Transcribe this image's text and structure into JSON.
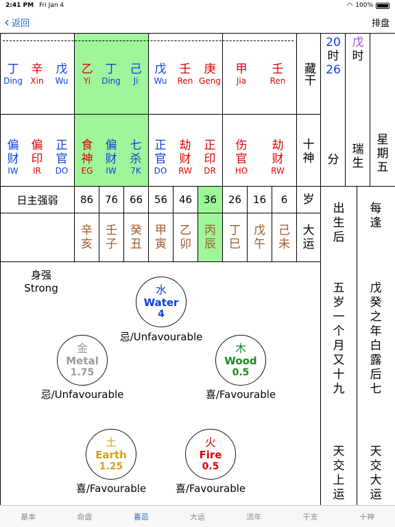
{
  "status": {
    "time": "2:41 PM",
    "date": "Fri Jan 4",
    "battery": "100%"
  },
  "nav": {
    "back_label": "返回",
    "right_label": "排盘"
  },
  "stems": [
    {
      "cols": [
        {
          "ch": "丁",
          "py": "Ding",
          "color": "blue"
        },
        {
          "ch": "辛",
          "py": "Xin",
          "color": "red"
        },
        {
          "ch": "戊",
          "py": "Wu",
          "color": "blue"
        }
      ]
    },
    {
      "cols": [
        {
          "ch": "乙",
          "py": "Yi",
          "color": "red"
        },
        {
          "ch": "丁",
          "py": "Ding",
          "color": "blue"
        },
        {
          "ch": "己",
          "py": "Ji",
          "color": "blue"
        }
      ]
    },
    {
      "cols": [
        {
          "ch": "戊",
          "py": "Wu",
          "color": "blue"
        },
        {
          "ch": "壬",
          "py": "Ren",
          "color": "red"
        },
        {
          "ch": "庚",
          "py": "Geng",
          "color": "red"
        }
      ]
    },
    {
      "cols": [
        {
          "ch": "甲",
          "py": "Jia",
          "color": "red"
        },
        {
          "ch": "壬",
          "py": "Ren",
          "color": "red"
        }
      ]
    }
  ],
  "gods": [
    {
      "cols": [
        {
          "a": "偏",
          "b": "财",
          "ab": "IW",
          "color": "blue"
        },
        {
          "a": "偏",
          "b": "印",
          "ab": "IR",
          "color": "red"
        },
        {
          "a": "正",
          "b": "官",
          "ab": "DO",
          "color": "blue"
        }
      ]
    },
    {
      "cols": [
        {
          "a": "食",
          "b": "神",
          "ab": "EG",
          "color": "red"
        },
        {
          "a": "偏",
          "b": "财",
          "ab": "IW",
          "color": "blue"
        },
        {
          "a": "七",
          "b": "杀",
          "ab": "7K",
          "color": "blue"
        }
      ]
    },
    {
      "cols": [
        {
          "a": "正",
          "b": "官",
          "ab": "DO",
          "color": "blue"
        },
        {
          "a": "劫",
          "b": "财",
          "ab": "RW",
          "color": "red"
        },
        {
          "a": "正",
          "b": "印",
          "ab": "DR",
          "color": "red"
        }
      ]
    },
    {
      "cols": [
        {
          "a": "伤",
          "b": "官",
          "ab": "HO",
          "color": "red"
        },
        {
          "a": "劫",
          "b": "财",
          "ab": "RW",
          "color": "red"
        }
      ]
    }
  ],
  "labels": {
    "canggan": "藏干",
    "shishen_a": "十",
    "shishen_b": "神",
    "rizhu": "日主强弱",
    "sui": "岁",
    "dayun_a": "大",
    "dayun_b": "运"
  },
  "ages": [
    "86",
    "76",
    "66",
    "56",
    "46",
    "36",
    "26",
    "16",
    "6"
  ],
  "luck": [
    {
      "a": "辛",
      "b": "亥"
    },
    {
      "a": "壬",
      "b": "子"
    },
    {
      "a": "癸",
      "b": "丑"
    },
    {
      "a": "甲",
      "b": "寅"
    },
    {
      "a": "乙",
      "b": "卯"
    },
    {
      "a": "丙",
      "b": "辰"
    },
    {
      "a": "丁",
      "b": "巳"
    },
    {
      "a": "戊",
      "b": "午"
    },
    {
      "a": "己",
      "b": "未"
    }
  ],
  "time_info": {
    "hour_a": "20",
    "hour_b": "时",
    "hour_c": "26",
    "min": "分",
    "wu": "戊",
    "shi": "时",
    "ruisheng_a": "瑞",
    "ruisheng_b": "生",
    "weekday": [
      "星",
      "期",
      "五"
    ]
  },
  "vertical": {
    "col1_top": [
      "出",
      "生",
      "后"
    ],
    "col1_mid": [
      "五",
      "岁",
      "一",
      "个",
      "月",
      "又",
      "十",
      "九"
    ],
    "col1_bot": [
      "天",
      "交",
      "上",
      "运"
    ],
    "col2_top": [
      "每",
      "逢"
    ],
    "col2_mid": [
      "戊",
      "癸",
      "之",
      "年",
      "白",
      "露",
      "后",
      "七"
    ],
    "col2_bot": [
      "天",
      "交",
      "大",
      "运"
    ]
  },
  "strength": {
    "cn": "身强",
    "en": "Strong"
  },
  "elements": [
    {
      "cn": "水",
      "en": "Water",
      "val": "4",
      "fav": "忌/Unfavourable",
      "color": "#0a3ee0"
    },
    {
      "cn": "金",
      "en": "Metal",
      "val": "1.75",
      "fav": "忌/Unfavourable",
      "color": "#9a9a9a"
    },
    {
      "cn": "木",
      "en": "Wood",
      "val": "0.5",
      "fav": "喜/Favourable",
      "color": "#1a8a1a"
    },
    {
      "cn": "土",
      "en": "Earth",
      "val": "1.25",
      "fav": "喜/Favourable",
      "color": "#d4a020"
    },
    {
      "cn": "火",
      "en": "Fire",
      "val": "0.5",
      "fav": "喜/Favourable",
      "color": "#e00000"
    }
  ],
  "tabs": [
    "基本",
    "命盘",
    "喜忌",
    "大运",
    "流年",
    "干支",
    "十神"
  ],
  "active_tab": 2
}
